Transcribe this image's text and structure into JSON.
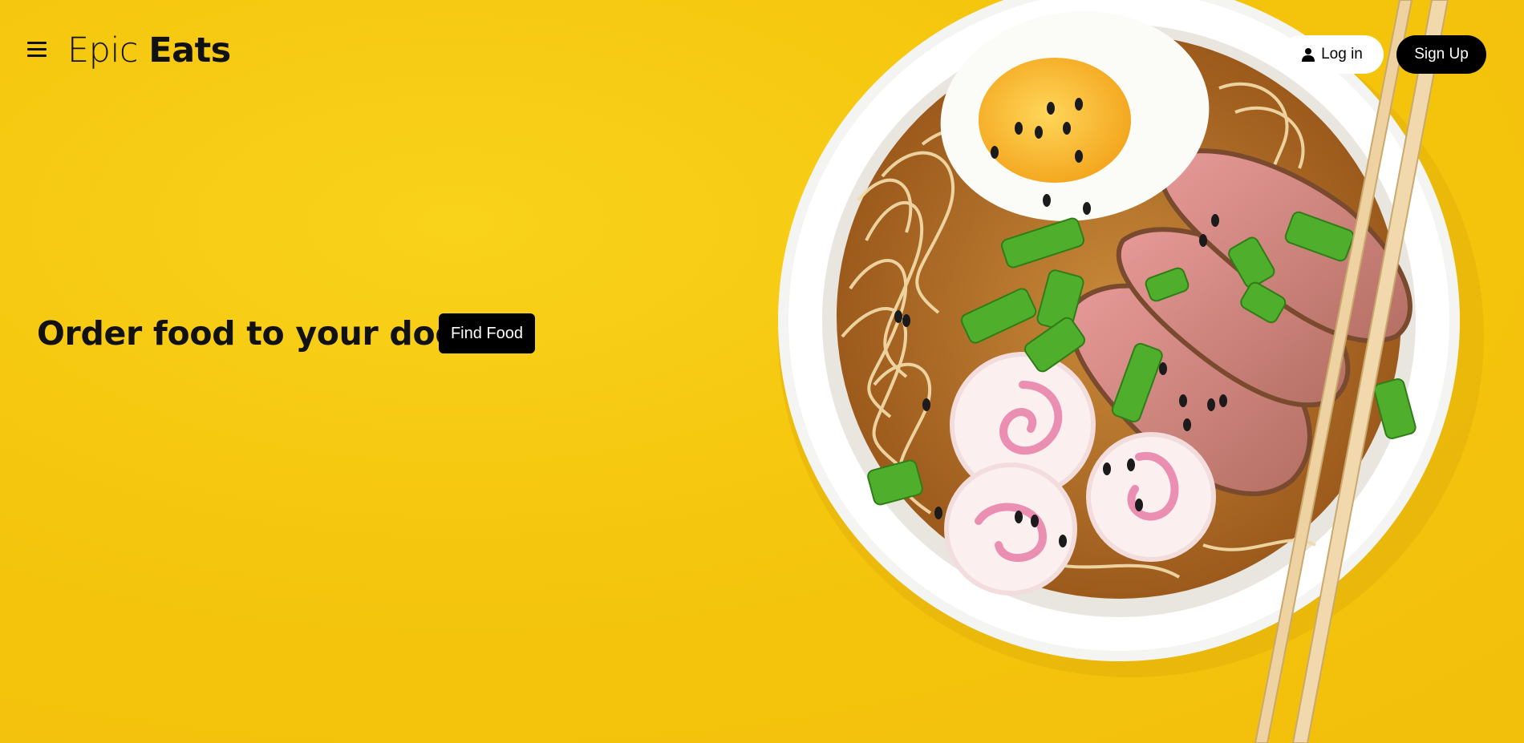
{
  "brand": {
    "light": "Epic",
    "bold": "Eats"
  },
  "header": {
    "login_label": "Log in",
    "signup_label": "Sign Up",
    "menu_icon": "hamburger-menu-icon",
    "user_icon": "user-icon"
  },
  "hero": {
    "tagline": "Order food to your door",
    "cta_label": "Find Food",
    "image": "ramen-bowl-illustration"
  },
  "colors": {
    "background": "#f5c60e",
    "primary": "#000000",
    "surface": "#ffffff"
  }
}
